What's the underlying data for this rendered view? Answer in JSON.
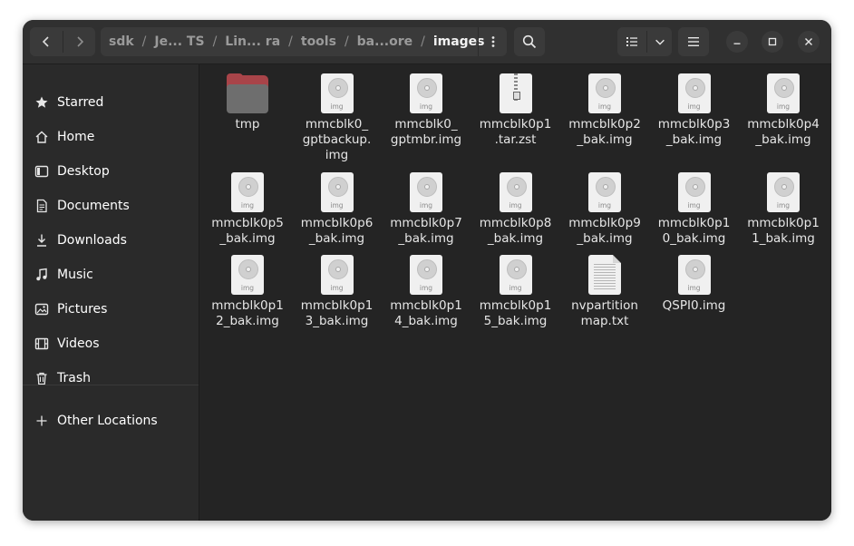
{
  "path": {
    "crumbs": [
      "sdk",
      "Je... TS",
      "Lin... ra",
      "tools",
      "ba...ore"
    ],
    "current": "images",
    "separator": "/"
  },
  "sidebar": {
    "items": [
      {
        "label": "Starred",
        "icon": "star-icon"
      },
      {
        "label": "Home",
        "icon": "home-icon"
      },
      {
        "label": "Desktop",
        "icon": "desktop-icon"
      },
      {
        "label": "Documents",
        "icon": "documents-icon"
      },
      {
        "label": "Downloads",
        "icon": "downloads-icon"
      },
      {
        "label": "Music",
        "icon": "music-icon"
      },
      {
        "label": "Pictures",
        "icon": "pictures-icon"
      },
      {
        "label": "Videos",
        "icon": "videos-icon"
      },
      {
        "label": "Trash",
        "icon": "trash-icon"
      }
    ],
    "other_locations": "Other Locations"
  },
  "files": [
    {
      "name": "tmp",
      "type": "folder"
    },
    {
      "name": "mmcblk0_gptbackup.img",
      "type": "img"
    },
    {
      "name": "mmcblk0_gptmbr.img",
      "type": "img"
    },
    {
      "name": "mmcblk0p1.tar.zst",
      "type": "zip"
    },
    {
      "name": "mmcblk0p2_bak.img",
      "type": "img"
    },
    {
      "name": "mmcblk0p3_bak.img",
      "type": "img"
    },
    {
      "name": "mmcblk0p4_bak.img",
      "type": "img"
    },
    {
      "name": "mmcblk0p5_bak.img",
      "type": "img"
    },
    {
      "name": "mmcblk0p6_bak.img",
      "type": "img"
    },
    {
      "name": "mmcblk0p7_bak.img",
      "type": "img"
    },
    {
      "name": "mmcblk0p8_bak.img",
      "type": "img"
    },
    {
      "name": "mmcblk0p9_bak.img",
      "type": "img"
    },
    {
      "name": "mmcblk0p10_bak.img",
      "type": "img"
    },
    {
      "name": "mmcblk0p11_bak.img",
      "type": "img"
    },
    {
      "name": "mmcblk0p12_bak.img",
      "type": "img"
    },
    {
      "name": "mmcblk0p13_bak.img",
      "type": "img"
    },
    {
      "name": "mmcblk0p14_bak.img",
      "type": "img"
    },
    {
      "name": "mmcblk0p15_bak.img",
      "type": "img"
    },
    {
      "name": "nvpartitionmap.txt",
      "type": "txt"
    },
    {
      "name": "QSPI0.img",
      "type": "img"
    }
  ],
  "icon_label": "img",
  "colors": {
    "window_bg": "#242424",
    "sidebar_bg": "#2a2a2a",
    "folder_accent": "#a84449"
  }
}
